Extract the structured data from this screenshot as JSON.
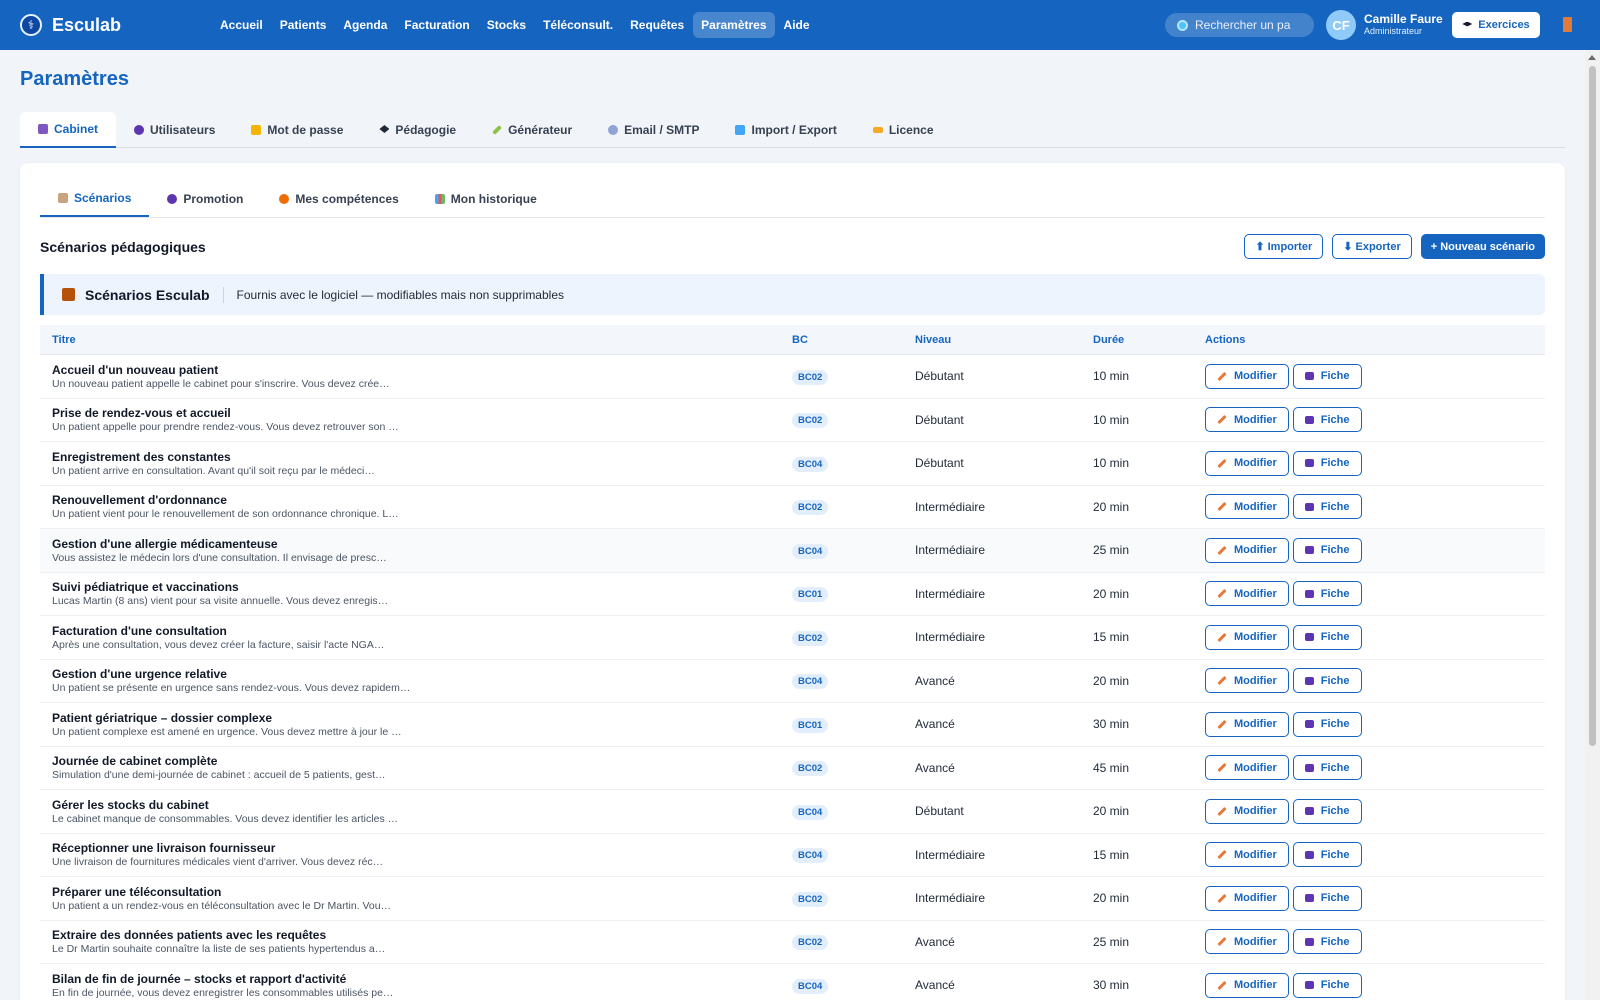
{
  "app": {
    "name": "Esculab"
  },
  "nav": [
    {
      "label": "Accueil"
    },
    {
      "label": "Patients"
    },
    {
      "label": "Agenda"
    },
    {
      "label": "Facturation"
    },
    {
      "label": "Stocks"
    },
    {
      "label": "Téléconsult."
    },
    {
      "label": "Requêtes"
    },
    {
      "label": "Paramètres",
      "active": true
    },
    {
      "label": "Aide"
    }
  ],
  "search": {
    "placeholder": "Rechercher un pa"
  },
  "user": {
    "initials": "CF",
    "name": "Camille Faure",
    "role": "Administrateur"
  },
  "exercises_button": "Exercices",
  "page_title": "Paramètres",
  "main_tabs": [
    {
      "label": "Cabinet",
      "icon": "building-icon",
      "active": true
    },
    {
      "label": "Utilisateurs",
      "icon": "users-icon"
    },
    {
      "label": "Mot de passe",
      "icon": "lock-icon"
    },
    {
      "label": "Pédagogie",
      "icon": "graduation-cap-icon"
    },
    {
      "label": "Générateur",
      "icon": "syringe-icon"
    },
    {
      "label": "Email / SMTP",
      "icon": "mail-icon"
    },
    {
      "label": "Import / Export",
      "icon": "sync-icon"
    },
    {
      "label": "Licence",
      "icon": "key-icon"
    }
  ],
  "sub_tabs": [
    {
      "label": "Scénarios",
      "icon": "clipboard-icon",
      "active": true
    },
    {
      "label": "Promotion",
      "icon": "users-icon"
    },
    {
      "label": "Mes compétences",
      "icon": "medal-icon"
    },
    {
      "label": "Mon historique",
      "icon": "bar-chart-icon"
    }
  ],
  "section": {
    "title": "Scénarios pédagogiques",
    "import_label": "⬆ Importer",
    "export_label": "⬇ Exporter",
    "new_label": "+ Nouveau scénario"
  },
  "banner": {
    "title": "Scénarios Esculab",
    "description": "Fournis avec le logiciel — modifiables mais non supprimables"
  },
  "table": {
    "columns": [
      "Titre",
      "BC",
      "Niveau",
      "Durée",
      "Actions"
    ],
    "edit_label": "Modifier",
    "sheet_label": "Fiche",
    "rows": [
      {
        "title": "Accueil d'un nouveau patient",
        "desc": "Un nouveau patient appelle le cabinet pour s'inscrire. Vous devez crée…",
        "bc": "BC02",
        "level": "Débutant",
        "duration": "10 min"
      },
      {
        "title": "Prise de rendez-vous et accueil",
        "desc": "Un patient appelle pour prendre rendez-vous. Vous devez retrouver son …",
        "bc": "BC02",
        "level": "Débutant",
        "duration": "10 min"
      },
      {
        "title": "Enregistrement des constantes",
        "desc": "Un patient arrive en consultation. Avant qu'il soit reçu par le médeci…",
        "bc": "BC04",
        "level": "Débutant",
        "duration": "10 min"
      },
      {
        "title": "Renouvellement d'ordonnance",
        "desc": "Un patient vient pour le renouvellement de son ordonnance chronique. L…",
        "bc": "BC02",
        "level": "Intermédiaire",
        "duration": "20 min"
      },
      {
        "title": "Gestion d'une allergie médicamenteuse",
        "desc": "Vous assistez le médecin lors d'une consultation. Il envisage de presc…",
        "bc": "BC04",
        "level": "Intermédiaire",
        "duration": "25 min"
      },
      {
        "title": "Suivi pédiatrique et vaccinations",
        "desc": "Lucas Martin (8 ans) vient pour sa visite annuelle. Vous devez enregis…",
        "bc": "BC01",
        "level": "Intermédiaire",
        "duration": "20 min"
      },
      {
        "title": "Facturation d'une consultation",
        "desc": "Après une consultation, vous devez créer la facture, saisir l'acte NGA…",
        "bc": "BC02",
        "level": "Intermédiaire",
        "duration": "15 min"
      },
      {
        "title": "Gestion d'une urgence relative",
        "desc": "Un patient se présente en urgence sans rendez-vous. Vous devez rapidem…",
        "bc": "BC04",
        "level": "Avancé",
        "duration": "20 min"
      },
      {
        "title": "Patient gériatrique – dossier complexe",
        "desc": "Un patient complexe est amené en urgence. Vous devez mettre à jour le …",
        "bc": "BC01",
        "level": "Avancé",
        "duration": "30 min"
      },
      {
        "title": "Journée de cabinet complète",
        "desc": "Simulation d'une demi-journée de cabinet : accueil de 5 patients, gest…",
        "bc": "BC02",
        "level": "Avancé",
        "duration": "45 min"
      },
      {
        "title": "Gérer les stocks du cabinet",
        "desc": "Le cabinet manque de consommables. Vous devez identifier les articles …",
        "bc": "BC04",
        "level": "Débutant",
        "duration": "20 min"
      },
      {
        "title": "Réceptionner une livraison fournisseur",
        "desc": "Une livraison de fournitures médicales vient d'arriver. Vous devez réc…",
        "bc": "BC04",
        "level": "Intermédiaire",
        "duration": "15 min"
      },
      {
        "title": "Préparer une téléconsultation",
        "desc": "Un patient a un rendez-vous en téléconsultation avec le Dr Martin. Vou…",
        "bc": "BC02",
        "level": "Intermédiaire",
        "duration": "20 min"
      },
      {
        "title": "Extraire des données patients avec les requêtes",
        "desc": "Le Dr Martin souhaite connaître la liste de ses patients hypertendus a…",
        "bc": "BC02",
        "level": "Avancé",
        "duration": "25 min"
      },
      {
        "title": "Bilan de fin de journée – stocks et rapport d'activité",
        "desc": "En fin de journée, vous devez enregistrer les consommables utilisés pe…",
        "bc": "BC04",
        "level": "Avancé",
        "duration": "30 min"
      }
    ]
  }
}
